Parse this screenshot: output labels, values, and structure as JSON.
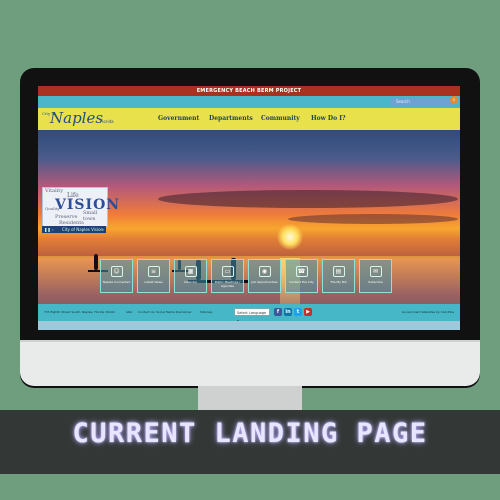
{
  "banner": "EMERGENCY BEACH BERM PROJECT",
  "search": {
    "placeholder": "Search"
  },
  "logo": {
    "prefix": "City of",
    "name": "Naples",
    "suffix": "Florida"
  },
  "nav": [
    "Government",
    "Departments",
    "Community",
    "How Do I?"
  ],
  "vision": {
    "words": [
      "Vitality",
      "Life",
      "Quality",
      "Preserve",
      "Small town",
      "Residents"
    ],
    "headline": "VISION",
    "caption": "City of Naples Vision"
  },
  "quick_links": [
    {
      "label": "Naples Connected",
      "icon": "☺"
    },
    {
      "label": "Latest News",
      "icon": "≡"
    },
    {
      "label": "Calendar",
      "icon": "▦"
    },
    {
      "label": "Public Meetings / Agendas",
      "icon": "▭"
    },
    {
      "label": "Job Opportunities",
      "icon": "◉"
    },
    {
      "label": "Contact the City",
      "icon": "☎"
    },
    {
      "label": "File My Bill",
      "icon": "▤"
    },
    {
      "label": "Subscribe",
      "icon": "✉"
    }
  ],
  "footer": {
    "left": "735 Eighth Street South, Naples, Florida 34102",
    "links": [
      "ADA",
      "Contact Us",
      "Social Media Disclaimer",
      "Sitemap"
    ],
    "language": "Select Language ▾",
    "right": "Government Websites by CivicPlus"
  },
  "social": [
    {
      "icon": "f",
      "color": "#3b5998"
    },
    {
      "icon": "in",
      "color": "#0e76a8"
    },
    {
      "icon": "t",
      "color": "#1da1f2"
    },
    {
      "icon": "▶",
      "color": "#c4302b"
    }
  ],
  "caption": "CURRENT LANDING PAGE"
}
